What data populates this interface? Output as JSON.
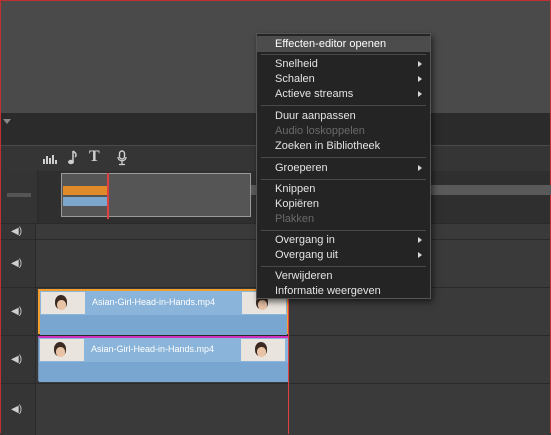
{
  "context_menu": {
    "items": [
      {
        "label": "Effecten-editor openen",
        "submenu": false,
        "disabled": false
      },
      {
        "label": "Snelheid",
        "submenu": true,
        "disabled": false
      },
      {
        "label": "Schalen",
        "submenu": true,
        "disabled": false
      },
      {
        "label": "Actieve streams",
        "submenu": true,
        "disabled": false
      },
      {
        "label": "Duur aanpassen",
        "submenu": false,
        "disabled": false
      },
      {
        "label": "Audio loskoppelen",
        "submenu": false,
        "disabled": true
      },
      {
        "label": "Zoeken in Bibliotheek",
        "submenu": false,
        "disabled": false
      },
      {
        "label": "Groeperen",
        "submenu": true,
        "disabled": false
      },
      {
        "label": "Knippen",
        "submenu": false,
        "disabled": false
      },
      {
        "label": "Kopiëren",
        "submenu": false,
        "disabled": false
      },
      {
        "label": "Plakken",
        "submenu": false,
        "disabled": true
      },
      {
        "label": "Overgang in",
        "submenu": true,
        "disabled": false
      },
      {
        "label": "Overgang uit",
        "submenu": true,
        "disabled": false
      },
      {
        "label": "Verwijderen",
        "submenu": false,
        "disabled": false
      },
      {
        "label": "Informatie weergeven",
        "submenu": false,
        "disabled": false
      }
    ]
  },
  "toolbar": {
    "icons": [
      "audio-mixer-icon",
      "music-note-icon",
      "title-text-icon",
      "microphone-icon"
    ],
    "text_icon_glyph": "T"
  },
  "timeline": {
    "clips": [
      {
        "name": "Asian-Girl-Head-in-Hands.mp4",
        "selected": true
      },
      {
        "name": "Asian-Girl-Head-in-Hands.mp4",
        "selected": false
      }
    ]
  },
  "colors": {
    "selected_clip_border": "#f0a030",
    "clip_accent_magenta": "#d030c0",
    "playhead": "#e04040",
    "clip_fill": "#8ab4d9"
  }
}
